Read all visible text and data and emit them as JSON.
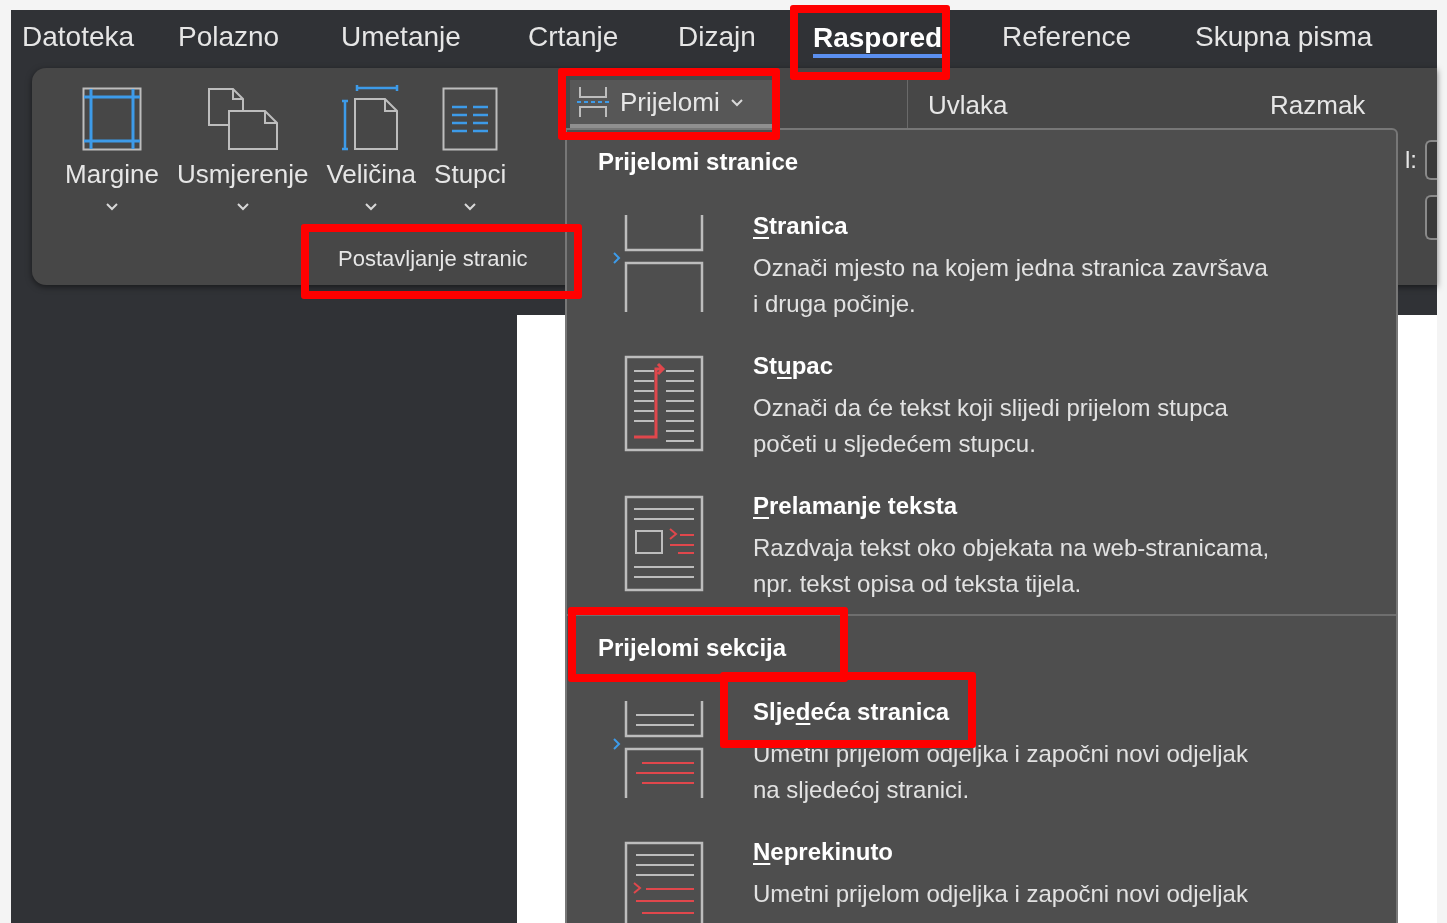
{
  "menu_tabs": [
    {
      "label": "Datoteka",
      "selected": false,
      "highlighted": false
    },
    {
      "label": "Polazno",
      "selected": false,
      "highlighted": false
    },
    {
      "label": "Umetanje",
      "selected": false,
      "highlighted": false
    },
    {
      "label": "Crtanje",
      "selected": false,
      "highlighted": false
    },
    {
      "label": "Dizajn",
      "selected": false,
      "highlighted": false
    },
    {
      "label": "Raspored",
      "selected": true,
      "highlighted": true
    },
    {
      "label": "Reference",
      "selected": false,
      "highlighted": false
    },
    {
      "label": "Skupna pisma",
      "selected": false,
      "highlighted": false
    }
  ],
  "ribbon": {
    "page_setup": {
      "buttons": [
        {
          "kind": "margins",
          "label": "Margine"
        },
        {
          "kind": "orientation",
          "label": "Usmjerenje"
        },
        {
          "kind": "size",
          "label": "Veličina"
        },
        {
          "kind": "columns",
          "label": "Stupci"
        }
      ],
      "group_label": "Postavljanje stranic",
      "highlighted": true
    },
    "breaks_button": {
      "label": "Prijelomi",
      "pressed": true,
      "highlighted": true
    },
    "indent_label": "Uvlaka",
    "spacing_label": "Razmak",
    "field_label": "l:"
  },
  "dropdown": {
    "sections": [
      {
        "header": "Prijelomi stranice",
        "highlighted": false,
        "items": [
          {
            "kind": "page",
            "title": {
              "key": "S",
              "after": "tranica"
            },
            "highlighted": false,
            "description": [
              "Označi mjesto na kojem jedna stranica završava",
              "i druga počinje."
            ]
          },
          {
            "kind": "column",
            "title": {
              "before": "St",
              "key": "u",
              "after": "pac"
            },
            "highlighted": false,
            "description": [
              "Označi da će tekst koji slijedi prijelom stupca",
              "početi u sljedećem stupcu."
            ]
          },
          {
            "kind": "text_wrapping",
            "title": {
              "key": "P",
              "after": "relamanje teksta"
            },
            "highlighted": false,
            "description": [
              "Razdvaja tekst oko objekata na web-stranicama,",
              "npr. tekst opisa od teksta tijela."
            ]
          }
        ]
      },
      {
        "header": "Prijelomi sekcija",
        "highlighted": true,
        "items": [
          {
            "kind": "next_page",
            "title": {
              "before": "Slje",
              "key": "d",
              "after": "eća stranica"
            },
            "highlighted": true,
            "description": [
              "Umetni prijelom odjeljka i započni novi odjeljak",
              "na sljedećoj stranici."
            ]
          },
          {
            "kind": "continuous",
            "title": {
              "key": "N",
              "after": "eprekinuto"
            },
            "highlighted": false,
            "description": [
              "Umetni prijelom odjeljka i započni novi odjeljak"
            ]
          }
        ]
      }
    ]
  }
}
